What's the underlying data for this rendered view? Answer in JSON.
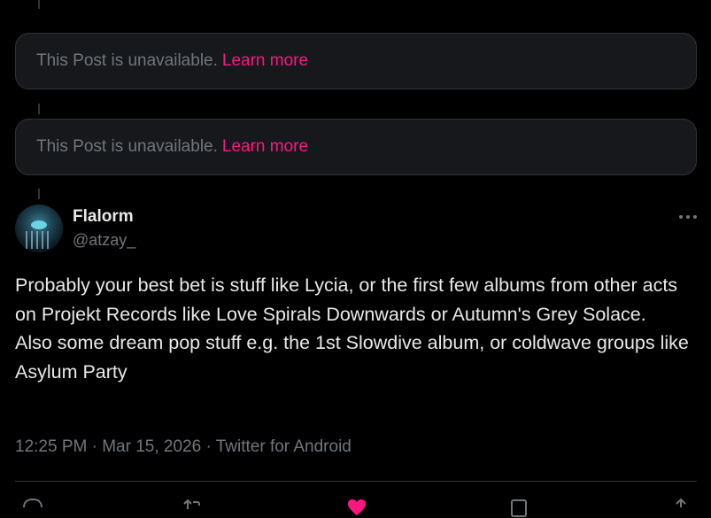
{
  "unavailable_posts": [
    {
      "message": "This Post is unavailable.",
      "link": "Learn more"
    },
    {
      "message": "This Post is unavailable.",
      "link": "Learn more"
    }
  ],
  "post": {
    "author_name": "Flalorm",
    "author_handle": "@atzay_",
    "more_icon": "more-horizontal-icon",
    "body_lines": [
      "Probably your best bet is stuff like Lycia, or the first few albums from other acts on Projekt Records like Love Spirals Downwards or Autumn's Grey Solace.",
      "Also some dream pop stuff e.g. the 1st Slowdive album, or coldwave groups like Asylum Party"
    ],
    "time": "12:25 PM",
    "date": "Mar 15, 2026",
    "source": "Twitter for Android"
  },
  "actions": [
    "reply-icon",
    "repost-icon",
    "like-icon",
    "bookmark-icon",
    "share-icon"
  ],
  "colors": {
    "accent": "#f91880",
    "muted": "#71767b",
    "text": "#e7e9ea",
    "border": "#2f3336",
    "background": "#000000"
  }
}
